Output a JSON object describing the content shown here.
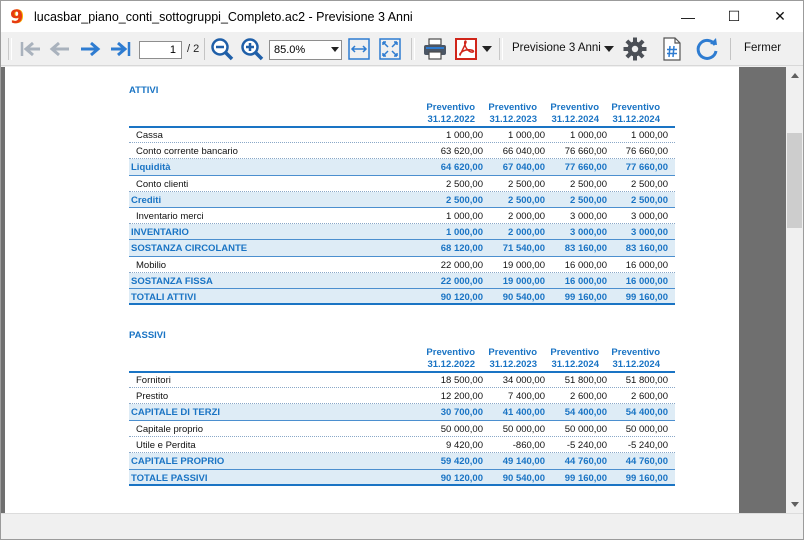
{
  "window": {
    "title": "lucasbar_piano_conti_sottogruppi_Completo.ac2 - Previsione 3 Anni",
    "logo_glyph": "9",
    "minimize_glyph": "—",
    "maximize_glyph": "☐",
    "close_glyph": "✕"
  },
  "toolbar": {
    "page_current": "1",
    "page_total": "/ 2",
    "zoom": "85.0%",
    "view": "Previsione 3 Anni",
    "close_label": "Fermer",
    "icons": [
      "first-page-icon",
      "prev-page-icon",
      "next-page-icon",
      "last-page-icon",
      "zoom-out-icon",
      "zoom-in-icon",
      "fit-width-icon",
      "fit-page-icon",
      "print-icon",
      "pdf-icon",
      "settings-icon",
      "format-icon",
      "refresh-icon"
    ]
  },
  "report": {
    "columns": [
      {
        "h1": "Preventivo",
        "h2": "31.12.2022"
      },
      {
        "h1": "Preventivo",
        "h2": "31.12.2023"
      },
      {
        "h1": "Preventivo",
        "h2": "31.12.2024"
      },
      {
        "h1": "Preventivo",
        "h2": "31.12.2024"
      }
    ],
    "attivi": {
      "title": "ATTIVI",
      "rows": [
        {
          "label": "Cassa",
          "type": "detail",
          "values": [
            "1 000,00",
            "1 000,00",
            "1 000,00",
            "1 000,00"
          ]
        },
        {
          "label": "Conto corrente bancario",
          "type": "detail",
          "values": [
            "63 620,00",
            "66 040,00",
            "76 660,00",
            "76 660,00"
          ]
        },
        {
          "label": "Liquidità",
          "type": "total",
          "values": [
            "64 620,00",
            "67 040,00",
            "77 660,00",
            "77 660,00"
          ]
        },
        {
          "label": "Conto clienti",
          "type": "detail",
          "values": [
            "2 500,00",
            "2 500,00",
            "2 500,00",
            "2 500,00"
          ]
        },
        {
          "label": "Crediti",
          "type": "total",
          "values": [
            "2 500,00",
            "2 500,00",
            "2 500,00",
            "2 500,00"
          ]
        },
        {
          "label": "Inventario merci",
          "type": "detail",
          "values": [
            "1 000,00",
            "2 000,00",
            "3 000,00",
            "3 000,00"
          ]
        },
        {
          "label": "INVENTARIO",
          "type": "total",
          "values": [
            "1 000,00",
            "2 000,00",
            "3 000,00",
            "3 000,00"
          ]
        },
        {
          "label": "SOSTANZA CIRCOLANTE",
          "type": "total",
          "values": [
            "68 120,00",
            "71 540,00",
            "83 160,00",
            "83 160,00"
          ]
        },
        {
          "label": "Mobilio",
          "type": "detail",
          "values": [
            "22 000,00",
            "19 000,00",
            "16 000,00",
            "16 000,00"
          ]
        },
        {
          "label": "SOSTANZA FISSA",
          "type": "total",
          "values": [
            "22 000,00",
            "19 000,00",
            "16 000,00",
            "16 000,00"
          ]
        },
        {
          "label": "TOTALI ATTIVI",
          "type": "grand",
          "values": [
            "90 120,00",
            "90 540,00",
            "99 160,00",
            "99 160,00"
          ]
        }
      ]
    },
    "passivi": {
      "title": "PASSIVI",
      "rows": [
        {
          "label": "Fornitori",
          "type": "detail",
          "values": [
            "18 500,00",
            "34 000,00",
            "51 800,00",
            "51 800,00"
          ]
        },
        {
          "label": "Prestito",
          "type": "detail",
          "values": [
            "12 200,00",
            "7 400,00",
            "2 600,00",
            "2 600,00"
          ]
        },
        {
          "label": "CAPITALE DI TERZI",
          "type": "total",
          "values": [
            "30 700,00",
            "41 400,00",
            "54 400,00",
            "54 400,00"
          ]
        },
        {
          "label": "Capitale proprio",
          "type": "detail",
          "values": [
            "50 000,00",
            "50 000,00",
            "50 000,00",
            "50 000,00"
          ]
        },
        {
          "label": "Utile e Perdita",
          "type": "detail",
          "values": [
            "9 420,00",
            "-860,00",
            "-5 240,00",
            "-5 240,00"
          ]
        },
        {
          "label": "CAPITALE PROPRIO",
          "type": "total",
          "values": [
            "59 420,00",
            "49 140,00",
            "44 760,00",
            "44 760,00"
          ]
        },
        {
          "label": "TOTALE PASSIVI",
          "type": "grand",
          "values": [
            "90 120,00",
            "90 540,00",
            "99 160,00",
            "99 160,00"
          ]
        }
      ]
    }
  }
}
